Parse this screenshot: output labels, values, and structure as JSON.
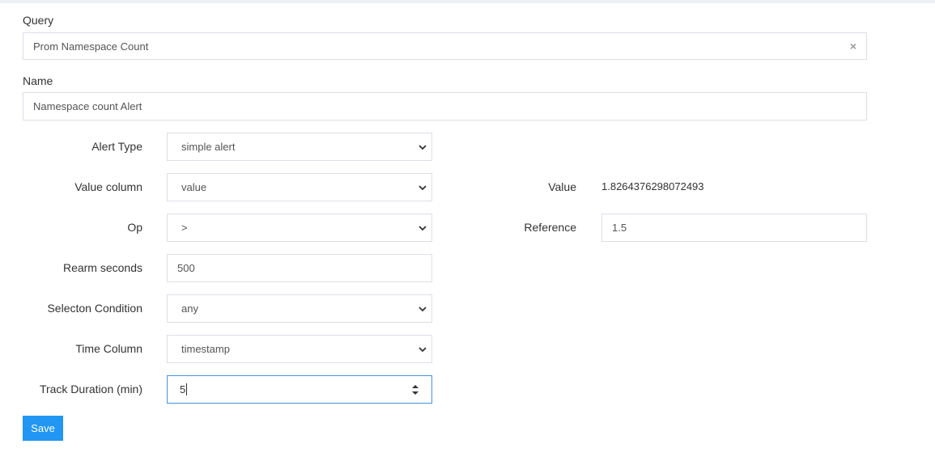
{
  "query": {
    "label": "Query",
    "value": "Prom Namespace Count",
    "clear_icon": "×"
  },
  "name": {
    "label": "Name",
    "value": "Namespace count Alert"
  },
  "alert_type": {
    "label": "Alert Type",
    "value": "simple alert"
  },
  "value_column": {
    "label": "Value column",
    "value": "value"
  },
  "op": {
    "label": "Op",
    "value": ">"
  },
  "rearm_seconds": {
    "label": "Rearm seconds",
    "value": "500"
  },
  "selection_condition": {
    "label": "Selecton Condition",
    "value": "any"
  },
  "time_column": {
    "label": "Time Column",
    "value": "timestamp"
  },
  "track_duration": {
    "label": "Track Duration (min)",
    "value": "5"
  },
  "value_display": {
    "label": "Value",
    "value": "1.8264376298072493"
  },
  "reference": {
    "label": "Reference",
    "value": "1.5"
  },
  "save_button": {
    "label": "Save",
    "color": "#2196f3"
  }
}
